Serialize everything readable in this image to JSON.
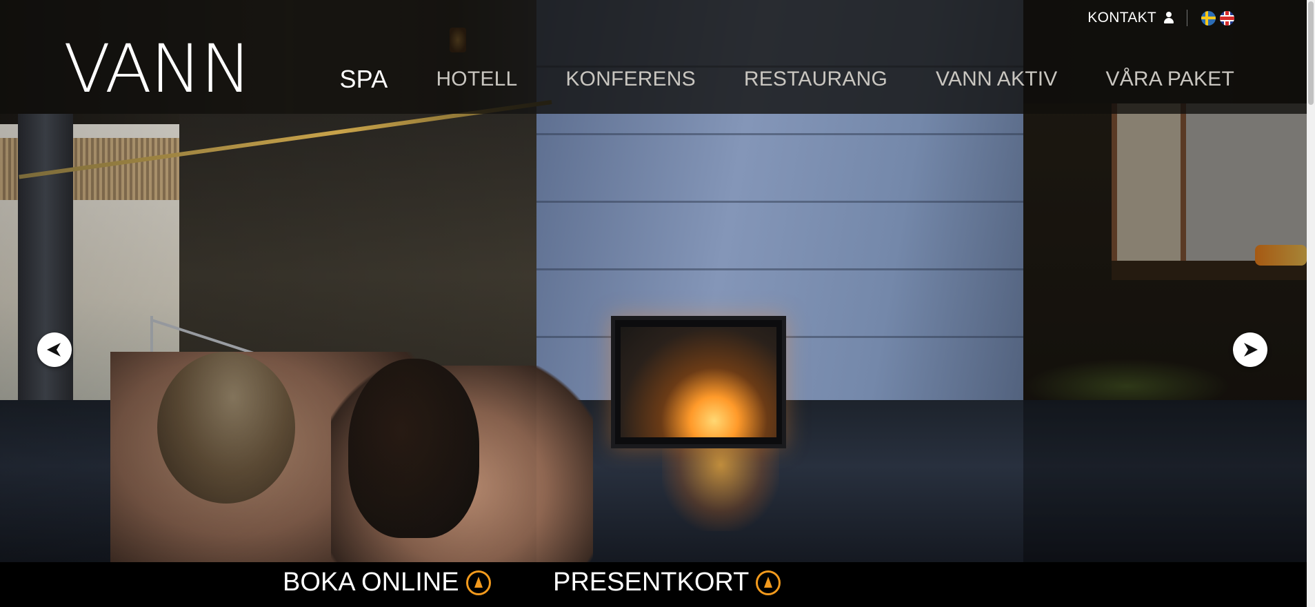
{
  "brand": {
    "logo": "VANN"
  },
  "topbar": {
    "contact_label": "KONTAKT",
    "languages": [
      "sv",
      "en"
    ]
  },
  "nav": {
    "items": [
      {
        "label": "SPA",
        "active": true
      },
      {
        "label": "HOTELL",
        "active": false
      },
      {
        "label": "KONFERENS",
        "active": false
      },
      {
        "label": "RESTAURANG",
        "active": false
      },
      {
        "label": "VANN AKTIV",
        "active": false
      },
      {
        "label": "VÅRA PAKET",
        "active": false
      }
    ]
  },
  "carousel": {
    "prev_icon": "arrow-left-icon",
    "next_icon": "arrow-right-icon"
  },
  "bottombar": {
    "cta": [
      {
        "label": "BOKA ONLINE",
        "icon": "arrow-up-circle-icon"
      },
      {
        "label": "PRESENTKORT",
        "icon": "arrow-up-circle-icon"
      }
    ]
  },
  "colors": {
    "accent": "#f39a1d",
    "header_bg": "#0f0e0c",
    "nav_text": "#c9c6c0",
    "active_text": "#ffffff"
  }
}
